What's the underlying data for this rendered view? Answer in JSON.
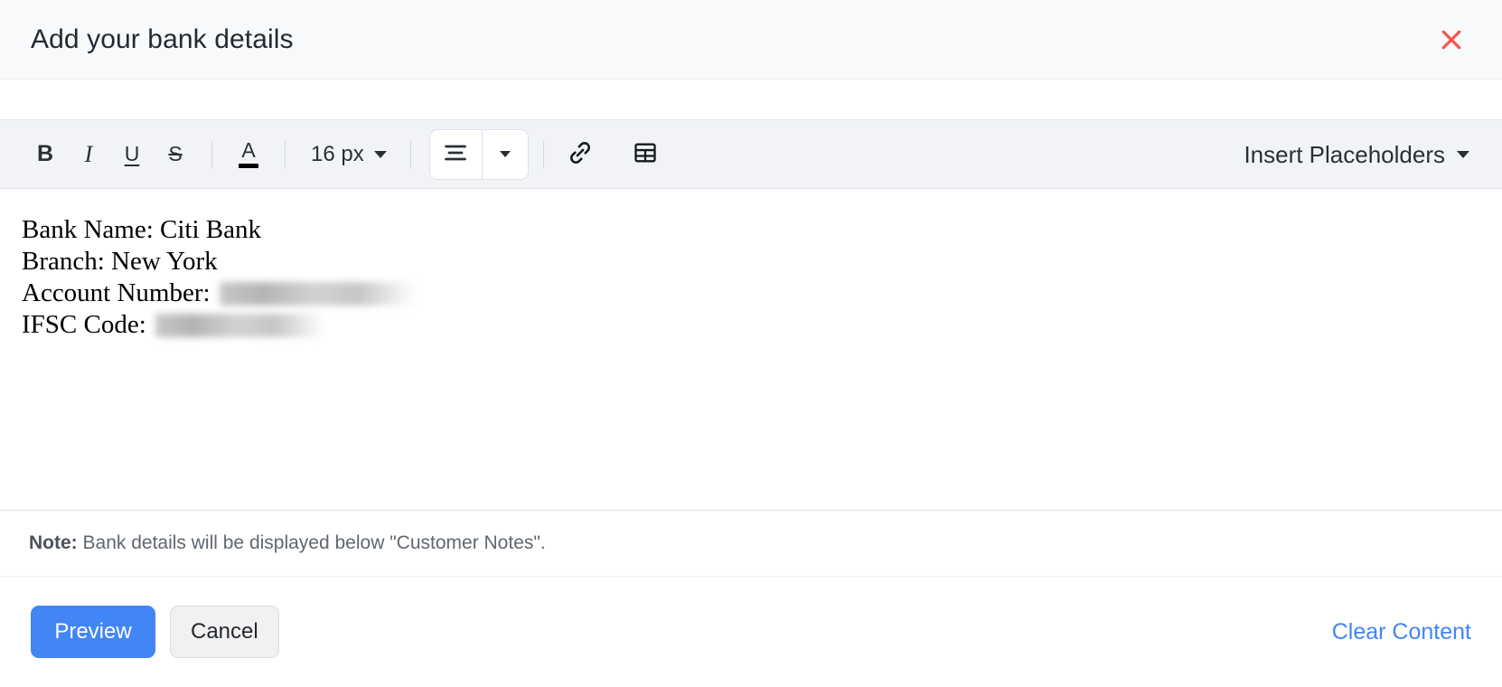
{
  "header": {
    "title": "Add your bank details",
    "close_icon": "close-icon",
    "close_color": "#f4564f"
  },
  "toolbar": {
    "bold_label": "B",
    "italic_label": "I",
    "underline_label": "U",
    "strikethrough_label": "S",
    "text_color_label": "A",
    "text_color_swatch": "#000000",
    "font_size_value": "16 px",
    "align_icon": "align-left-icon",
    "align_caret_icon": "chevron-down-icon",
    "link_icon": "link-icon",
    "table_icon": "table-icon",
    "placeholders_label": "Insert Placeholders",
    "placeholders_caret_icon": "chevron-down-icon"
  },
  "editor": {
    "lines": [
      {
        "label": "Bank Name: Citi Bank",
        "redacted": false
      },
      {
        "label": "Branch: New York",
        "redacted": false
      },
      {
        "label": "Account Number:",
        "redacted": true
      },
      {
        "label": "IFSC Code:",
        "redacted": true
      }
    ]
  },
  "note": {
    "prefix": "Note:",
    "text": "Bank details will be displayed below \"Customer Notes\"."
  },
  "footer": {
    "preview_label": "Preview",
    "cancel_label": "Cancel",
    "clear_label": "Clear Content",
    "primary_color": "#4285f4"
  }
}
